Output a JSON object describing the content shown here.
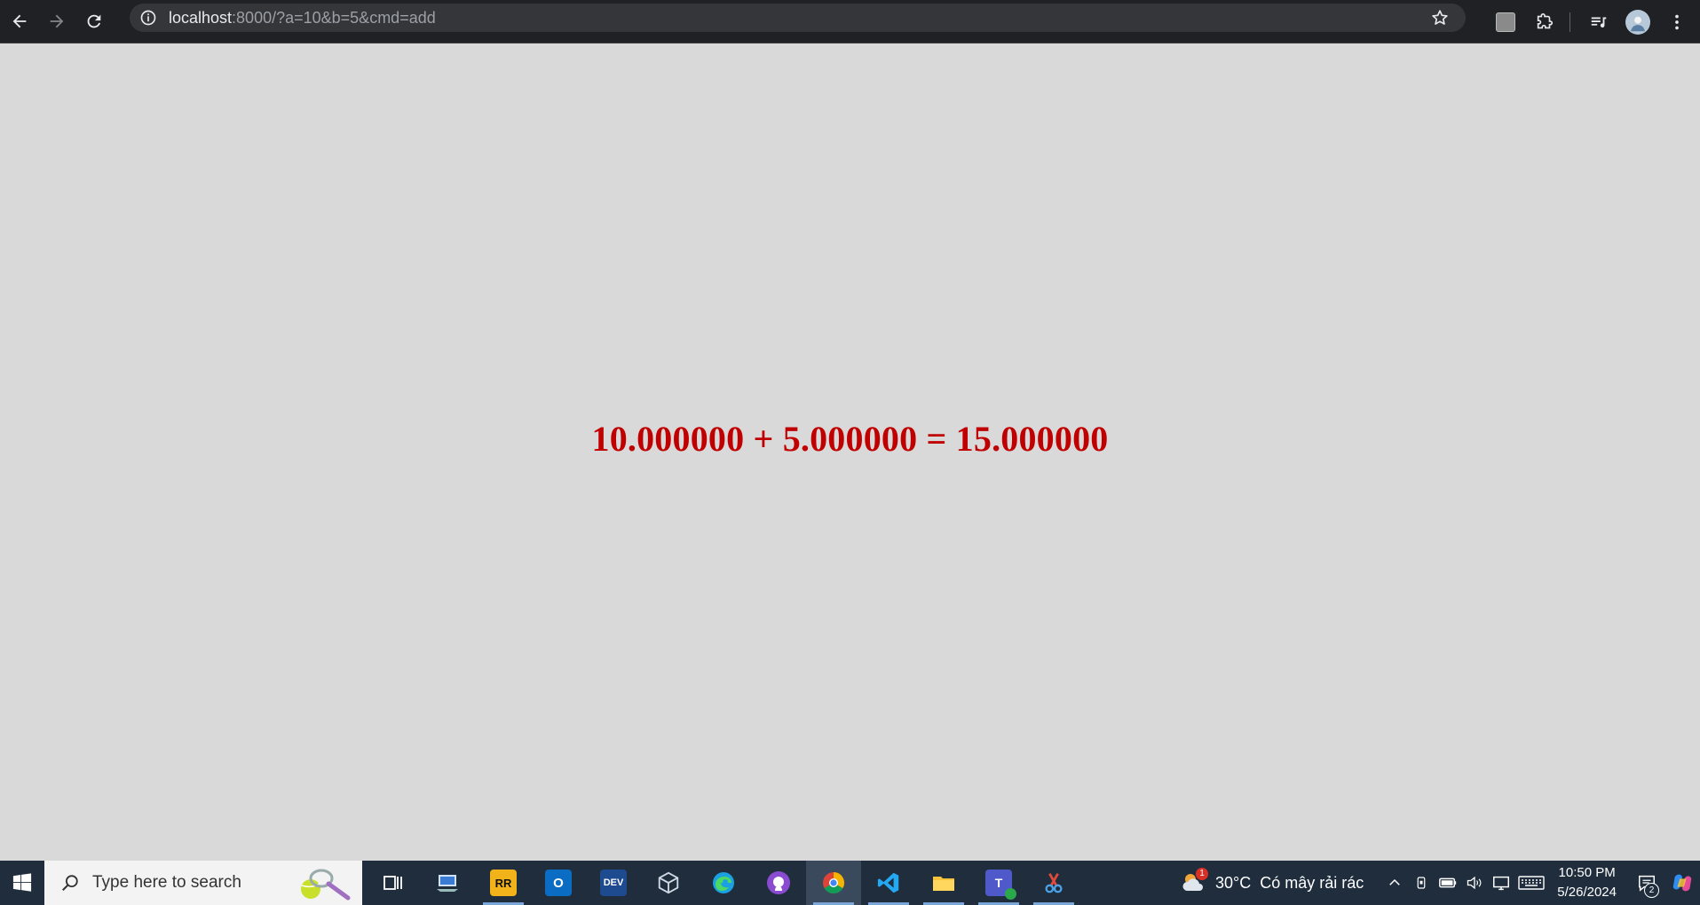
{
  "browser": {
    "url_host": "localhost",
    "url_rest": ":8000/?a=10&b=5&cmd=add"
  },
  "page": {
    "result_text": "10.000000 + 5.000000 = 15.000000",
    "text_color": "#c00000",
    "background": "#d9d9d9"
  },
  "taskbar": {
    "search_placeholder": "Type here to search",
    "apps": [
      {
        "name": "task-view"
      },
      {
        "name": "remote-desktop"
      },
      {
        "name": "rr-preview",
        "label": "RR"
      },
      {
        "name": "outlook",
        "label": "O"
      },
      {
        "name": "devexpress",
        "label": "DEV"
      },
      {
        "name": "virtualbox"
      },
      {
        "name": "edge"
      },
      {
        "name": "github-desktop"
      },
      {
        "name": "chrome"
      },
      {
        "name": "vscode"
      },
      {
        "name": "file-explorer"
      },
      {
        "name": "teams",
        "label": "T"
      },
      {
        "name": "snipping-tool"
      }
    ],
    "weather": {
      "temperature": "30°C",
      "description": "Có mây rải rác",
      "badge": "1"
    },
    "clock": {
      "time": "10:50 PM",
      "date": "5/26/2024"
    },
    "notification_count": "2"
  }
}
